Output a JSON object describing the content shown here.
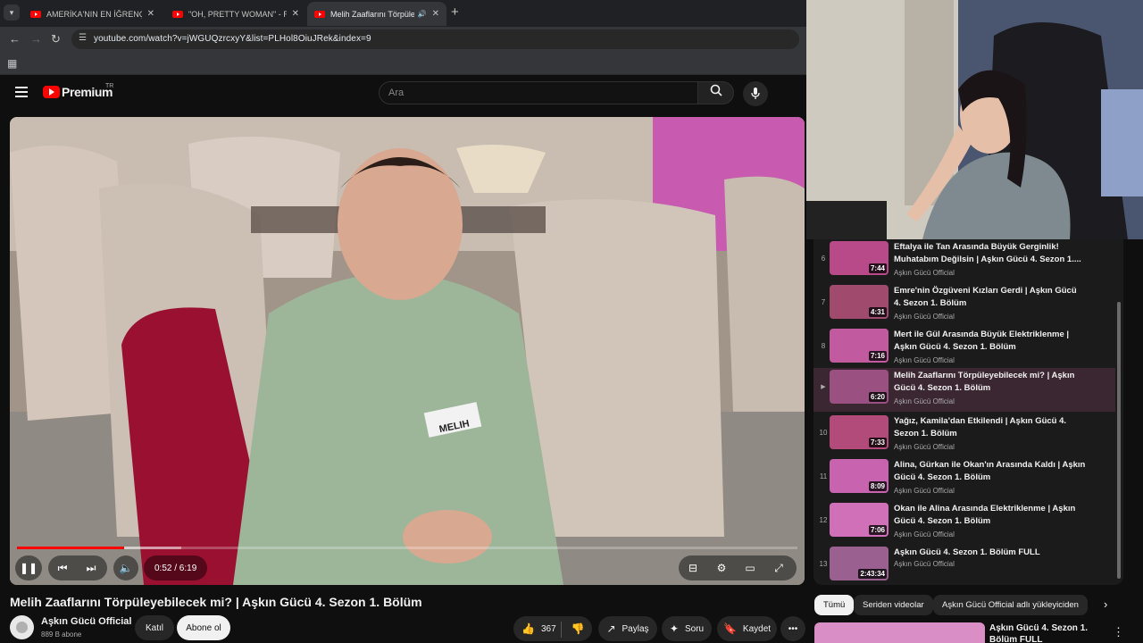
{
  "browser": {
    "tabs": [
      {
        "title": "AMERİKA'NIN EN İĞRENÇ PROJ",
        "active": false,
        "audio": false
      },
      {
        "title": "\"OH, PRETTY WOMAN\" - Roy O",
        "active": false,
        "audio": false
      },
      {
        "title": "Melih Zaaflarını Törpüleyebi",
        "active": true,
        "audio": true
      }
    ],
    "url": "youtube.com/watch?v=jWGUQzrcxyY&list=PLHol8OiuJRek&index=9"
  },
  "header": {
    "logo_text": "Premium",
    "region": "TR",
    "search_placeholder": "Ara"
  },
  "player": {
    "time": "0:52 / 6:19",
    "progress_played": 0.137,
    "progress_buffered": 0.21,
    "name_badge": "MELIH"
  },
  "video": {
    "title": "Melih Zaaflarını Törpüleyebilecek mi? | Aşkın Gücü 4. Sezon 1. Bölüm",
    "channel": "Aşkın Gücü Official",
    "subscribers": "889 B abone",
    "join_label": "Katıl",
    "subscribe_label": "Abone ol",
    "likes": "367",
    "share_label": "Paylaş",
    "ask_label": "Soru",
    "save_label": "Kaydet"
  },
  "playlist": {
    "items": [
      {
        "index": "6",
        "title": "Eftalya ile Tan Arasında Büyük Gerginlik! Muhatabım Değilsin | Aşkın Gücü 4. Sezon 1....",
        "channel": "Aşkın Gücü Official",
        "duration": "7:44",
        "active": false,
        "color": "#b84a8a"
      },
      {
        "index": "7",
        "title": "Emre'nin Özgüveni Kızları Gerdi | Aşkın Gücü 4. Sezon 1. Bölüm",
        "channel": "Aşkın Gücü Official",
        "duration": "4:31",
        "active": false,
        "color": "#a04a6e"
      },
      {
        "index": "8",
        "title": "Mert ile Gül Arasında Büyük Elektriklenme | Aşkın Gücü 4. Sezon 1. Bölüm",
        "channel": "Aşkın Gücü Official",
        "duration": "7:16",
        "active": false,
        "color": "#c25aa0"
      },
      {
        "index": "",
        "title": "Melih Zaaflarını Törpüleyebilecek mi? | Aşkın Gücü 4. Sezon 1. Bölüm",
        "channel": "Aşkın Gücü Official",
        "duration": "6:20",
        "active": true,
        "color": "#9a5080"
      },
      {
        "index": "10",
        "title": "Yağız, Kamila'dan Etkilendi | Aşkın Gücü 4. Sezon 1. Bölüm",
        "channel": "Aşkın Gücü Official",
        "duration": "7:33",
        "active": false,
        "color": "#b24a7a"
      },
      {
        "index": "11",
        "title": "Alina, Gürkan ile Okan'ın Arasında Kaldı | Aşkın Gücü 4. Sezon 1. Bölüm",
        "channel": "Aşkın Gücü Official",
        "duration": "8:09",
        "active": false,
        "color": "#c863b0"
      },
      {
        "index": "12",
        "title": "Okan ile Alina Arasında Elektriklenme | Aşkın Gücü 4. Sezon 1. Bölüm",
        "channel": "Aşkın Gücü Official",
        "duration": "7:06",
        "active": false,
        "color": "#d070b8"
      },
      {
        "index": "13",
        "title": "Aşkın Gücü 4. Sezon 1. Bölüm FULL",
        "channel": "Aşkın Gücü Official",
        "duration": "2:43:34",
        "active": false,
        "color": "#9a6090"
      }
    ]
  },
  "chips": [
    "Tümü",
    "Seriden videolar",
    "Aşkın Gücü Official adlı yükleyiciden"
  ],
  "recommendation": {
    "title": "Aşkın Gücü 4. Sezon 1. Bölüm FULL"
  }
}
